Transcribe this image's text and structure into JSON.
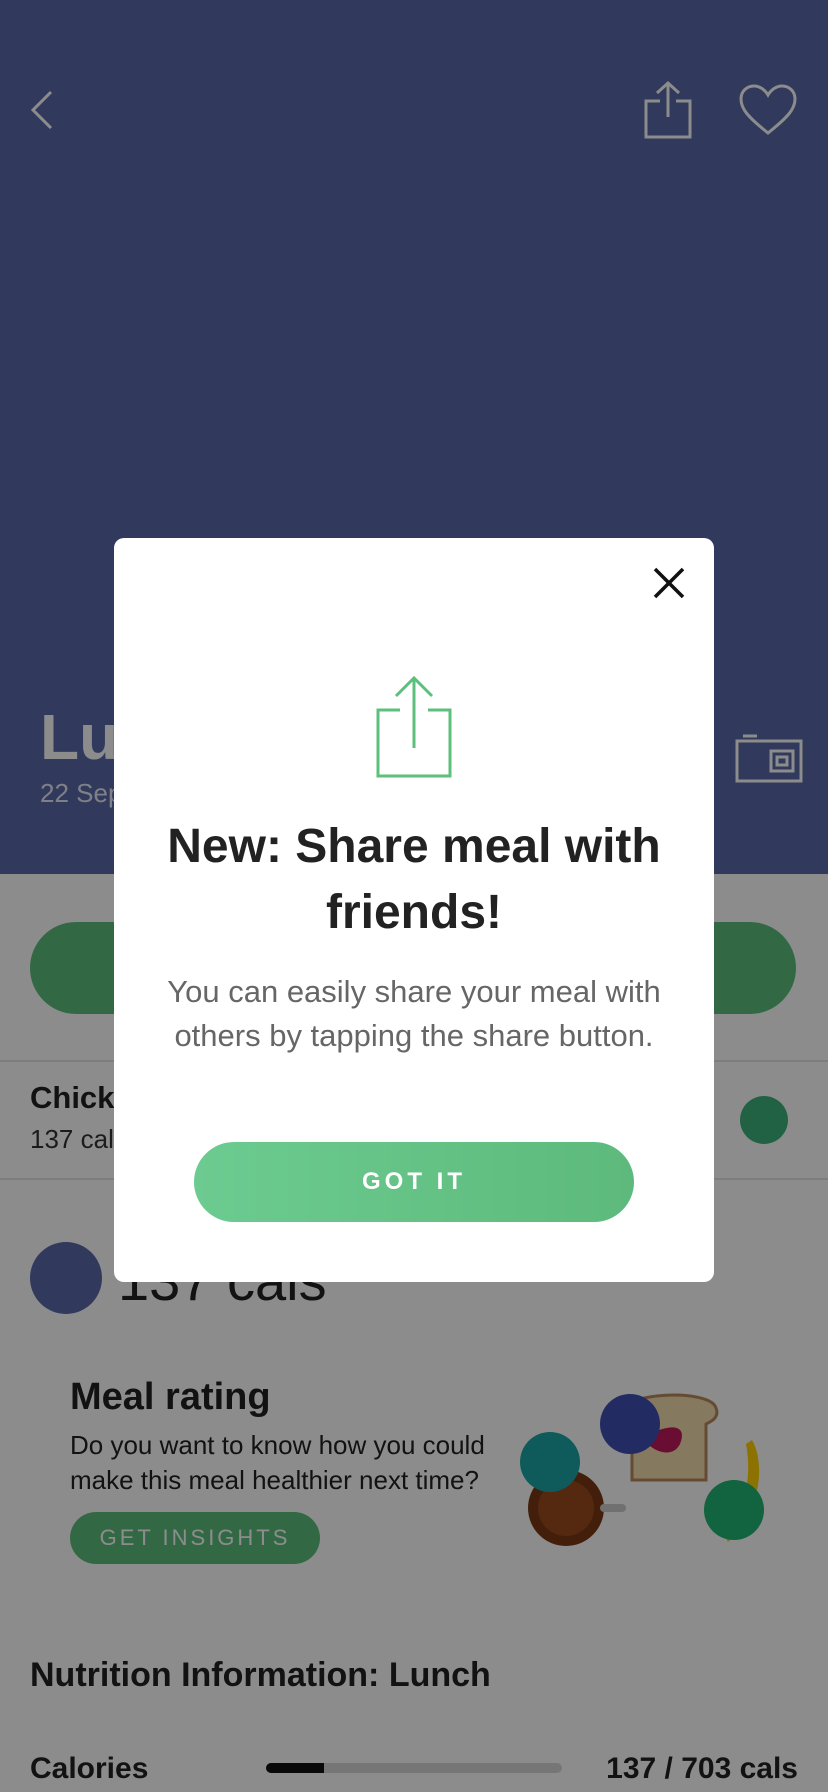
{
  "hero": {
    "title": "Lunch",
    "date": "22 Sep",
    "color": "#5a6aa9"
  },
  "icons": {
    "back": "chevron-left-icon",
    "share": "share-icon",
    "favorite": "heart-icon",
    "camera": "camera-icon"
  },
  "food_item": {
    "name": "Chicken",
    "cals": "137 cals",
    "rating_icon": "smiley-icon"
  },
  "summary": {
    "cals": "137 cals"
  },
  "meal_rating": {
    "title": "Meal rating",
    "text": "Do you want to know how you could make this meal healthier next time?",
    "button": "GET INSIGHTS"
  },
  "nutrition": {
    "title": "Nutrition Information: Lunch",
    "calories_label": "Calories",
    "calories_value": "137 / 703 cals",
    "calories_fraction": 0.195
  },
  "modal": {
    "title": "New: Share meal with friends!",
    "text": "You can easily share your meal with others by tapping the share button.",
    "button": "GOT IT",
    "accent": "#5cc07c"
  }
}
